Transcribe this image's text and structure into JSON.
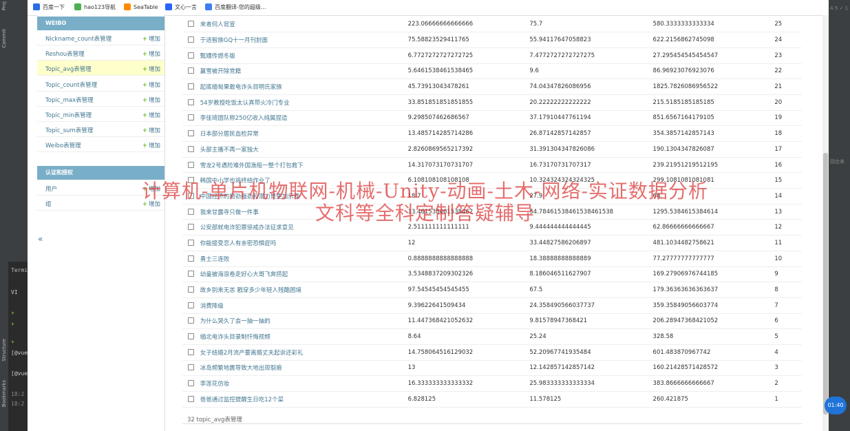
{
  "bookmarks": [
    {
      "label": "百度一下",
      "icon": "paw-icon",
      "color": "#2b6de5"
    },
    {
      "label": "hao123导航",
      "icon": "leaf-icon",
      "color": "#4caf50"
    },
    {
      "label": "SeaTable",
      "icon": "flame-icon",
      "color": "#ff8a00"
    },
    {
      "label": "文心一言",
      "icon": "swirl-icon",
      "color": "#2962ff"
    },
    {
      "label": "百度翻译-您的超级...",
      "icon": "translate-icon",
      "color": "#3f7ef2"
    }
  ],
  "ide": {
    "left_tabs": [
      "Proj",
      "Commit",
      "Structure",
      "Bookmarks"
    ],
    "terminal_label": "Termi",
    "terminal_lines": [
      "VI",
      "+",
      "+",
      "+",
      "[@vue",
      "[@vue",
      "18:2",
      "18:2"
    ],
    "right_text": "A 5 ✓ 1",
    "right_side": "回合来"
  },
  "sidebar": {
    "weibo_header": "WEIBO",
    "add_label": "增加",
    "weibo_items": [
      {
        "label": "Nickname_count表管理"
      },
      {
        "label": "Reshou表管理"
      },
      {
        "label": "Topic_avg表管理",
        "active": true
      },
      {
        "label": "Topic_count表管理"
      },
      {
        "label": "Topic_max表管理"
      },
      {
        "label": "Topic_min表管理"
      },
      {
        "label": "Topic_sum表管理"
      },
      {
        "label": "Weibo表管理"
      }
    ],
    "auth_header": "认证和授权",
    "auth_items": [
      {
        "label": "用户"
      },
      {
        "label": "组"
      }
    ],
    "collapse_glyph": "«"
  },
  "table": {
    "rows": [
      {
        "title": "来者何人官宣",
        "c1": "223.06666666666666",
        "c2": "75.7",
        "c3": "580.3333333333334",
        "id": "25"
      },
      {
        "title": "于适智族GQ十一月刊封面",
        "c1": "75.58823529411765",
        "c2": "55.94117647058823",
        "c3": "622.2156862745098",
        "id": "24"
      },
      {
        "title": "甄嬛传燃冬版",
        "c1": "6.7727272727272725",
        "c2": "7.4772727272727275",
        "c3": "27.295454545454547",
        "id": "23"
      },
      {
        "title": "赢雪被开除党籍",
        "c1": "5.6461538461538465",
        "c2": "9.6",
        "c3": "86.96923076923076",
        "id": "22"
      },
      {
        "title": "起底缅甸果敢电诈头目明氏家族",
        "c1": "45.73913043478261",
        "c2": "74.04347826086956",
        "c3": "1825.7826086956522",
        "id": "21"
      },
      {
        "title": "54岁教授吃饭太认真带火冷门专业",
        "c1": "33.851851851851855",
        "c2": "20.22222222222222",
        "c3": "215.5185185185185",
        "id": "20"
      },
      {
        "title": "李佳琦团队称250亿收入纯属捏造",
        "c1": "9.298507462686567",
        "c2": "37.17910447761194",
        "c3": "851.6567164179105",
        "id": "19"
      },
      {
        "title": "日本部分居民血检异常",
        "c1": "13.485714285714286",
        "c2": "26.87142857142857",
        "c3": "354.3857142857143",
        "id": "18"
      },
      {
        "title": "头部主播不再一家独大",
        "c1": "2.8260869565217392",
        "c2": "31.391304347826086",
        "c3": "190.1304347826087",
        "id": "17"
      },
      {
        "title": "雪龙2号遇险难外国渔船一整个打包救下",
        "c1": "14.317073170731707",
        "c2": "16.73170731707317",
        "c3": "239.21951219512195",
        "id": "16"
      },
      {
        "title": "韩国中小学也将终结作业了",
        "c1": "6.108108108108108",
        "c2": "10.324324324324325",
        "c3": "299.1081081081081",
        "id": "15"
      },
      {
        "title": "中国经济的韧劲强劲和潜力是更加乐观",
        "c1": "18.7",
        "c2": "27.9",
        "c3": "68.",
        "id": "14"
      },
      {
        "title": "我来甘露寺只做一件事",
        "c1": "13.461538461538462",
        "c2": "54.78461538461538461538",
        "c3": "1295.5384615384614",
        "id": "13"
      },
      {
        "title": "公安部就电诈犯罪惩戒办法征求意见",
        "c1": "2.511111111111111",
        "c2": "9.444444444444445",
        "c3": "62.86666666666667",
        "id": "12"
      },
      {
        "title": "你能接受恋人有亲密恐惧症吗",
        "c1": "12",
        "c2": "33.44827586206897",
        "c3": "481.1034482758621",
        "id": "11"
      },
      {
        "title": "勇士三连败",
        "c1": "0.8888888888888888",
        "c2": "18.38888888888889",
        "c3": "77.27777777777777",
        "id": "10"
      },
      {
        "title": "幼童被海浪卷走好心大哥飞奔捞起",
        "c1": "3.5348837209302326",
        "c2": "8.186046511627907",
        "c3": "169.27906976744185",
        "id": "9"
      },
      {
        "title": "故乡别来无恙 戳穿多少年轻人残酷困境",
        "c1": "97.54545454545455",
        "c2": "67.5",
        "c3": "179.36363636363637",
        "id": "8"
      },
      {
        "title": "消费降级",
        "c1": "9.39622641509434",
        "c2": "24.358490566037737",
        "c3": "359.35849056603774",
        "id": "7"
      },
      {
        "title": "为什么哭久了会一抽一抽的",
        "c1": "11.447368421052632",
        "c2": "9.81578947368421",
        "c3": "206.28947368421052",
        "id": "6"
      },
      {
        "title": "缅北电诈头目录制忏悔视频",
        "c1": "8.64",
        "c2": "25.24",
        "c3": "328.58",
        "id": "5"
      },
      {
        "title": "女子结婚2月流产要离婚丈夫起诉还彩礼",
        "c1": "14.758064516129032",
        "c2": "52.20967741935484",
        "c3": "601.483870967742",
        "id": "4"
      },
      {
        "title": "冰岛频繁地震导致大地出现裂痕",
        "c1": "13",
        "c2": "12.142857142857142",
        "c3": "160.21428571428572",
        "id": "3"
      },
      {
        "title": "李莲花仿妆",
        "c1": "16.333333333333332",
        "c2": "25.983333333333334",
        "c3": "383.8666666666667",
        "id": "2"
      },
      {
        "title": "爸爸通过监控提醒生日吃12个菜",
        "c1": "6.828125",
        "c2": "11.578125",
        "c3": "260.421875",
        "id": "1"
      }
    ],
    "footer_count": "32 topic_avg表管理"
  },
  "watermark": {
    "line1": "计算机-单片机物联网-机械-Unity-动画-土木-网络-实证数据分析",
    "line2": "文科等全科定制答疑辅导"
  },
  "timer": "01:40"
}
